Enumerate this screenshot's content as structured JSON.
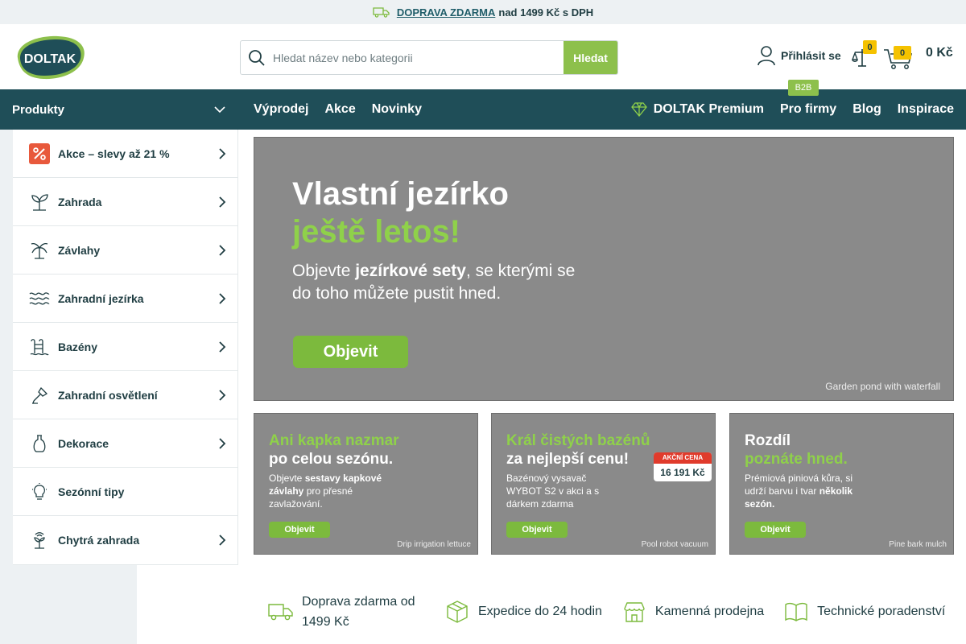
{
  "topbar": {
    "shipping_link": "DOPRAVA ZDARMA",
    "shipping_rest": "nad 1499 Kč s DPH"
  },
  "header": {
    "logo_text": "DOLTAK",
    "search_placeholder": "Hledat název nebo kategorii",
    "search_button": "Hledat",
    "login_label": "Přihlásit se",
    "compare_count": "0",
    "cart_count": "0",
    "cart_total": "0 Kč"
  },
  "nav": {
    "products_label": "Produkty",
    "left_items": [
      "Výprodej",
      "Akce",
      "Novinky"
    ],
    "premium_label": "DOLTAK Premium",
    "firmy_label": "Pro firmy",
    "b2b_badge": "B2B",
    "blog_label": "Blog",
    "inspirace_label": "Inspirace"
  },
  "sidebar": {
    "items": [
      {
        "label": "Akce – slevy až 21 %",
        "icon": "percent-icon",
        "has_arrow": true
      },
      {
        "label": "Zahrada",
        "icon": "plant-icon",
        "has_arrow": true
      },
      {
        "label": "Závlahy",
        "icon": "sprinkler-icon",
        "has_arrow": true
      },
      {
        "label": "Zahradní jezírka",
        "icon": "waves-icon",
        "has_arrow": true
      },
      {
        "label": "Bazény",
        "icon": "pool-ladder-icon",
        "has_arrow": true
      },
      {
        "label": "Zahradní osvětlení",
        "icon": "lamp-icon",
        "has_arrow": true
      },
      {
        "label": "Dekorace",
        "icon": "vase-icon",
        "has_arrow": true
      },
      {
        "label": "Sezónní tipy",
        "icon": "lightbulb-icon",
        "has_arrow": false
      },
      {
        "label": "Chytrá zahrada",
        "icon": "smart-plant-icon",
        "has_arrow": true
      }
    ]
  },
  "hero": {
    "line1": "Vlastní jezírko",
    "line2": "ještě letos!",
    "p_pre": "Objevte ",
    "p_bold": "jezírkové sety",
    "p_post": ", se kterými se do toho můžete pustit hned.",
    "button": "Objevit",
    "image_label": "Garden pond with waterfall"
  },
  "banners": [
    {
      "h1": "Ani kapka nazmar",
      "h2": "po celou sezónu.",
      "h2_green": false,
      "h1_green": true,
      "p_pre": "Objevte ",
      "p_bold": "sestavy kapkové závlahy",
      "p_post": " pro přesné zavlažování.",
      "button": "Objevit",
      "image_label": "Drip irrigation lettuce"
    },
    {
      "h1": "Král čistých bazénů",
      "h2": "za nejlepší cenu!",
      "h2_green": false,
      "h1_green": true,
      "p_pre": "Bazénový vysavač WYBOT S2 v akci a s dárkem zdarma",
      "p_bold": "",
      "p_post": "",
      "button": "Objevit",
      "price_label": "AKČNÍ CENA",
      "price_value": "16 191 Kč",
      "image_label": "Pool robot vacuum"
    },
    {
      "h1": "Rozdíl",
      "h2": "poznáte hned.",
      "h2_green": true,
      "h1_green": false,
      "p_pre": "Prémiová piniová kůra, si udrží barvu i tvar ",
      "p_bold": "několik sezón.",
      "p_post": "",
      "button": "Objevit",
      "image_label": "Pine bark mulch"
    }
  ],
  "usp": [
    {
      "label": "Doprava zdarma od 1499 Kč",
      "icon": "truck-icon"
    },
    {
      "label": "Expedice do 24 hodin",
      "icon": "package-icon"
    },
    {
      "label": "Kamenná prodejna",
      "icon": "store-icon"
    },
    {
      "label": "Technické poradenství",
      "icon": "book-icon"
    }
  ],
  "colors": {
    "brand_dark": "#1f4e58",
    "brand_green": "#8dc04c",
    "badge_yellow": "#f5c200",
    "text": "#1f3d42"
  }
}
